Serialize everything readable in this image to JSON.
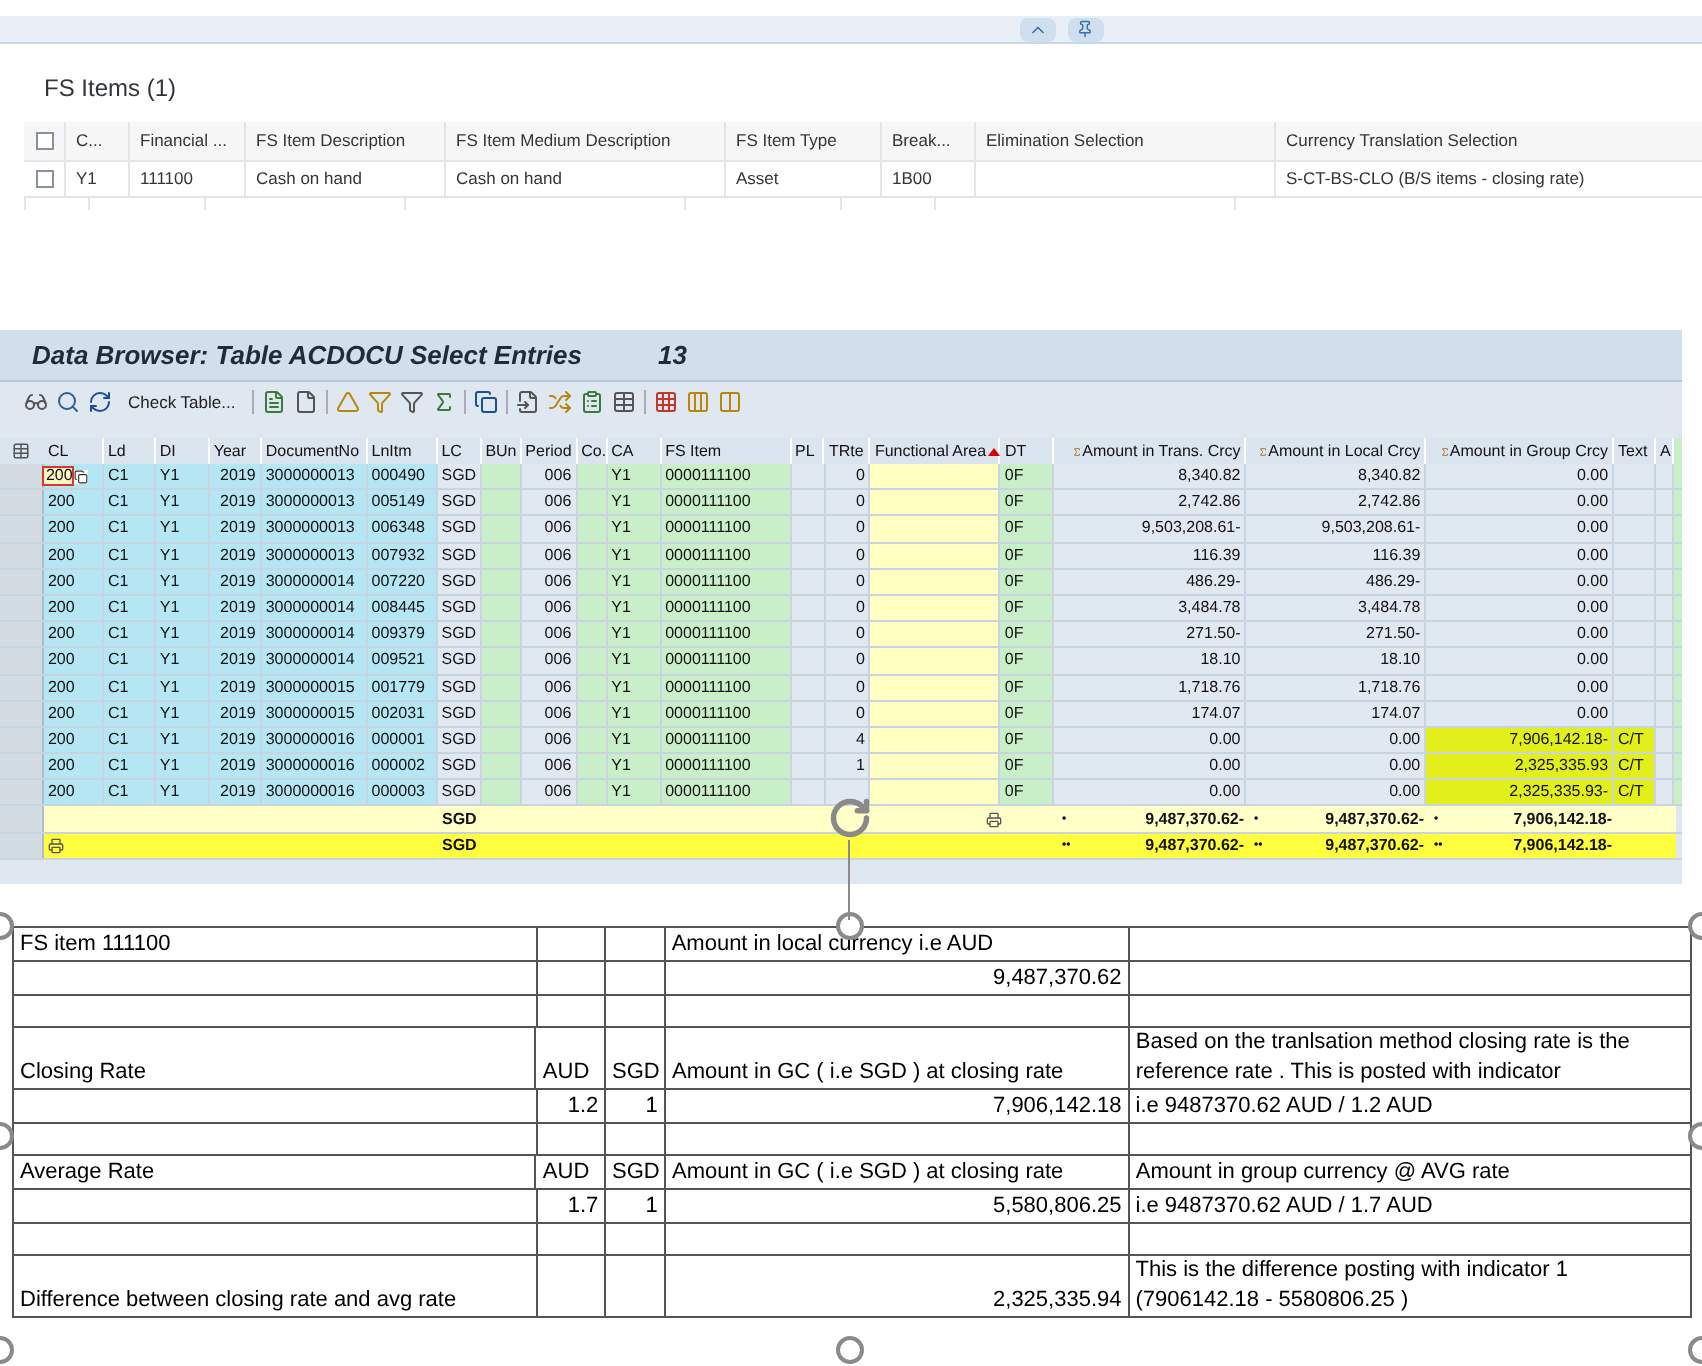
{
  "fiori": {
    "title": "FS Items (1)",
    "header_checked": false,
    "columns": [
      "C...",
      "Financial ...",
      "FS Item Description",
      "FS Item Medium Description",
      "FS Item Type",
      "Break...",
      "Elimination Selection",
      "Currency Translation Selection"
    ],
    "rows": [
      {
        "checked": false,
        "cells": [
          "Y1",
          "111100",
          "Cash on hand",
          "Cash on hand",
          "Asset",
          "1B00",
          null,
          "S-CT-BS-CLO (B/S items - closing rate)"
        ]
      }
    ]
  },
  "data_browser": {
    "title": "Data Browser: Table ACDOCU Select Entries",
    "count": "13",
    "check_table": "Check Table...",
    "columns": [
      "CL",
      "Ld",
      "DI",
      "Year",
      "DocumentNo",
      "LnItm",
      "LC",
      "BUn",
      "Period",
      "Co.",
      "CA",
      "FS Item",
      "PL",
      "TRte",
      "Functional Area",
      "DT",
      "Amount in Trans. Crcy",
      "Amount in Local Crcy",
      "Amount in Group Crcy",
      "Text",
      "A"
    ],
    "rows": [
      {
        "focused": true,
        "highlighted": false,
        "cl": "200",
        "ld": "C1",
        "di": "Y1",
        "year": "2019",
        "doc": "3000000013",
        "lnitm": "000490",
        "lc": "SGD",
        "period": "006",
        "ca": "Y1",
        "fs_item": "0000111100",
        "trte": "0",
        "dt": "0F",
        "amt_trans": "8,340.82",
        "amt_local": "8,340.82",
        "amt_group": "0.00"
      },
      {
        "focused": false,
        "highlighted": false,
        "cl": "200",
        "ld": "C1",
        "di": "Y1",
        "year": "2019",
        "doc": "3000000013",
        "lnitm": "005149",
        "lc": "SGD",
        "period": "006",
        "ca": "Y1",
        "fs_item": "0000111100",
        "trte": "0",
        "dt": "0F",
        "amt_trans": "2,742.86",
        "amt_local": "2,742.86",
        "amt_group": "0.00"
      },
      {
        "focused": false,
        "highlighted": false,
        "cl": "200",
        "ld": "C1",
        "di": "Y1",
        "year": "2019",
        "doc": "3000000013",
        "lnitm": "006348",
        "lc": "SGD",
        "period": "006",
        "ca": "Y1",
        "fs_item": "0000111100",
        "trte": "0",
        "dt": "0F",
        "amt_trans": "9,503,208.61-",
        "amt_local": "9,503,208.61-",
        "amt_group": "0.00"
      },
      {
        "focused": false,
        "highlighted": false,
        "cl": "200",
        "ld": "C1",
        "di": "Y1",
        "year": "2019",
        "doc": "3000000013",
        "lnitm": "007932",
        "lc": "SGD",
        "period": "006",
        "ca": "Y1",
        "fs_item": "0000111100",
        "trte": "0",
        "dt": "0F",
        "amt_trans": "116.39",
        "amt_local": "116.39",
        "amt_group": "0.00"
      },
      {
        "focused": false,
        "highlighted": false,
        "cl": "200",
        "ld": "C1",
        "di": "Y1",
        "year": "2019",
        "doc": "3000000014",
        "lnitm": "007220",
        "lc": "SGD",
        "period": "006",
        "ca": "Y1",
        "fs_item": "0000111100",
        "trte": "0",
        "dt": "0F",
        "amt_trans": "486.29-",
        "amt_local": "486.29-",
        "amt_group": "0.00"
      },
      {
        "focused": false,
        "highlighted": false,
        "cl": "200",
        "ld": "C1",
        "di": "Y1",
        "year": "2019",
        "doc": "3000000014",
        "lnitm": "008445",
        "lc": "SGD",
        "period": "006",
        "ca": "Y1",
        "fs_item": "0000111100",
        "trte": "0",
        "dt": "0F",
        "amt_trans": "3,484.78",
        "amt_local": "3,484.78",
        "amt_group": "0.00"
      },
      {
        "focused": false,
        "highlighted": false,
        "cl": "200",
        "ld": "C1",
        "di": "Y1",
        "year": "2019",
        "doc": "3000000014",
        "lnitm": "009379",
        "lc": "SGD",
        "period": "006",
        "ca": "Y1",
        "fs_item": "0000111100",
        "trte": "0",
        "dt": "0F",
        "amt_trans": "271.50-",
        "amt_local": "271.50-",
        "amt_group": "0.00"
      },
      {
        "focused": false,
        "highlighted": false,
        "cl": "200",
        "ld": "C1",
        "di": "Y1",
        "year": "2019",
        "doc": "3000000014",
        "lnitm": "009521",
        "lc": "SGD",
        "period": "006",
        "ca": "Y1",
        "fs_item": "0000111100",
        "trte": "0",
        "dt": "0F",
        "amt_trans": "18.10",
        "amt_local": "18.10",
        "amt_group": "0.00"
      },
      {
        "focused": false,
        "highlighted": false,
        "cl": "200",
        "ld": "C1",
        "di": "Y1",
        "year": "2019",
        "doc": "3000000015",
        "lnitm": "001779",
        "lc": "SGD",
        "period": "006",
        "ca": "Y1",
        "fs_item": "0000111100",
        "trte": "0",
        "dt": "0F",
        "amt_trans": "1,718.76",
        "amt_local": "1,718.76",
        "amt_group": "0.00"
      },
      {
        "focused": false,
        "highlighted": false,
        "cl": "200",
        "ld": "C1",
        "di": "Y1",
        "year": "2019",
        "doc": "3000000015",
        "lnitm": "002031",
        "lc": "SGD",
        "period": "006",
        "ca": "Y1",
        "fs_item": "0000111100",
        "trte": "0",
        "dt": "0F",
        "amt_trans": "174.07",
        "amt_local": "174.07",
        "amt_group": "0.00"
      },
      {
        "focused": false,
        "highlighted": true,
        "cl": "200",
        "ld": "C1",
        "di": "Y1",
        "year": "2019",
        "doc": "3000000016",
        "lnitm": "000001",
        "lc": "SGD",
        "period": "006",
        "ca": "Y1",
        "fs_item": "0000111100",
        "trte": "4",
        "dt": "0F",
        "amt_trans": "0.00",
        "amt_local": "0.00",
        "amt_group": "7,906,142.18-",
        "text": "C/T"
      },
      {
        "focused": false,
        "highlighted": true,
        "cl": "200",
        "ld": "C1",
        "di": "Y1",
        "year": "2019",
        "doc": "3000000016",
        "lnitm": "000002",
        "lc": "SGD",
        "period": "006",
        "ca": "Y1",
        "fs_item": "0000111100",
        "trte": "1",
        "dt": "0F",
        "amt_trans": "0.00",
        "amt_local": "0.00",
        "amt_group": "2,325,335.93",
        "text": "C/T"
      },
      {
        "focused": false,
        "highlighted": true,
        "cl": "200",
        "ld": "C1",
        "di": "Y1",
        "year": "2019",
        "doc": "3000000016",
        "lnitm": "000003",
        "lc": "SGD",
        "period": "006",
        "ca": "Y1",
        "fs_item": "0000111100",
        "dt": "0F",
        "amt_trans": "0.00",
        "amt_local": "0.00",
        "amt_group": "2,325,335.93-",
        "text": "C/T"
      }
    ],
    "totals": [
      {
        "kind": "subtotal",
        "lc": "SGD",
        "mark": "•",
        "amt_trans": "9,487,370.62-",
        "amt_local": "9,487,370.62-",
        "amt_group": "7,906,142.18-"
      },
      {
        "kind": "total",
        "lc": "SGD",
        "mark": "••",
        "amt_trans": "9,487,370.62-",
        "amt_local": "9,487,370.62-",
        "amt_group": "7,906,142.18-"
      }
    ]
  },
  "sheet": {
    "rows": [
      {
        "kind": "heading",
        "cells": [
          "FS item 111100",
          null,
          null,
          "Amount in local currency i.e AUD",
          null
        ]
      },
      {
        "kind": "value",
        "cells": [
          null,
          null,
          null,
          "9,487,370.62",
          null
        ]
      },
      {
        "kind": "blank",
        "cells": [
          null,
          null,
          null,
          null,
          null
        ]
      },
      {
        "kind": "heading",
        "cells": [
          "Closing Rate",
          "AUD",
          "SGD",
          "Amount in GC ( i.e SGD ) at closing rate",
          "Based on the tranlsation method closing rate is the reference rate . This is posted with indicator"
        ]
      },
      {
        "kind": "value",
        "cells": [
          null,
          "1.2",
          "1",
          "7,906,142.18",
          "i.e 9487370.62 AUD / 1.2 AUD"
        ]
      },
      {
        "kind": "blank",
        "cells": [
          null,
          null,
          null,
          null,
          null
        ]
      },
      {
        "kind": "heading",
        "cells": [
          "Average Rate",
          "AUD",
          "SGD",
          "Amount in GC ( i.e SGD ) at closing rate",
          "Amount in group currency @ AVG rate"
        ]
      },
      {
        "kind": "value",
        "cells": [
          null,
          "1.7",
          "1",
          "5,580,806.25",
          "i.e 9487370.62 AUD / 1.7 AUD"
        ]
      },
      {
        "kind": "blank",
        "cells": [
          null,
          null,
          null,
          null,
          null
        ]
      },
      {
        "kind": "heading",
        "cells": [
          "Difference between closing rate and avg rate",
          null,
          null,
          "2,325,335.94",
          "This is the difference posting with indicator 1 (7906142.18 - 5580806.25 )"
        ]
      }
    ]
  }
}
